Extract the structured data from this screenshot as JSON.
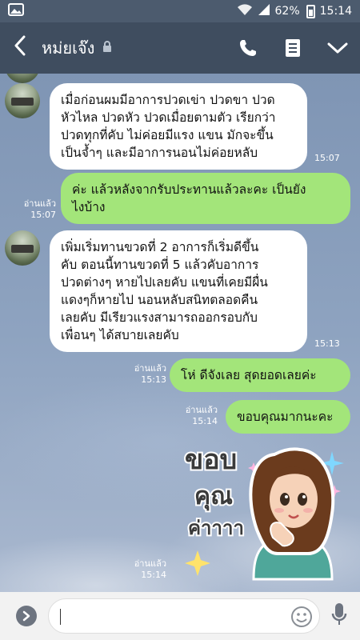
{
  "status": {
    "battery": "62%",
    "time": "15:14"
  },
  "header": {
    "title": "หม่ยเจ๊ง"
  },
  "messages": [
    {
      "side": "in",
      "text": "เมื่อก่อนผมมีอาการปวดเข่า ปวดขา ปวด\nหัวไหล ปวดหัว ปวดเมื่อยตามตัว เรียกว่า\nปวดทุกที่คับ ไม่ค่อยมีแรง แขน มักจะขึ้น\nเป็นจ้ำๆ และมีอาการนอนไม่ค่อยหลับ",
      "time": "15:07"
    },
    {
      "side": "out",
      "text": "ค่ะ แล้วหลังจากรับประทานแล้วละคะ เป็นยัง\nไงบ้าง",
      "read": "อ่านแล้ว",
      "time": "15:07"
    },
    {
      "side": "in",
      "text": "เพิ่มเริ่มทานขวดที่ 2 อาการก็เริ่มดีขึ้น\nคับ ตอนนี้ทานขวดที่ 5 แล้วคับอาการ\nปวดต่างๆ หายไปเลยคับ แขนที่เคยมีผื่น\nแดงๆก็หายไป นอนหลับสนิทตลอดคืน\nเลยคับ มีเรียวแรงสามารถออกรอบกับ\nเพื่อนๆ ได้สบายเลยคับ",
      "time": "15:13"
    },
    {
      "side": "out",
      "text": "โห่ ดีจังเลย สุดยอดเลยค่ะ",
      "read": "อ่านแล้ว",
      "time": "15:13"
    },
    {
      "side": "out",
      "text": "ขอบคุณมากนะคะ",
      "read": "อ่านแล้ว",
      "time": "15:14"
    }
  ],
  "sticker": {
    "text_line1": "ขอบ",
    "text_line2": "คุณ",
    "text_line3": "ค่าาาา",
    "read": "อ่านแล้ว",
    "time": "15:14"
  },
  "input": {
    "value": ""
  },
  "colors": {
    "header": "#3f4d5f",
    "outgoing_bubble": "#a3e57a",
    "incoming_bubble": "#ffffff"
  }
}
